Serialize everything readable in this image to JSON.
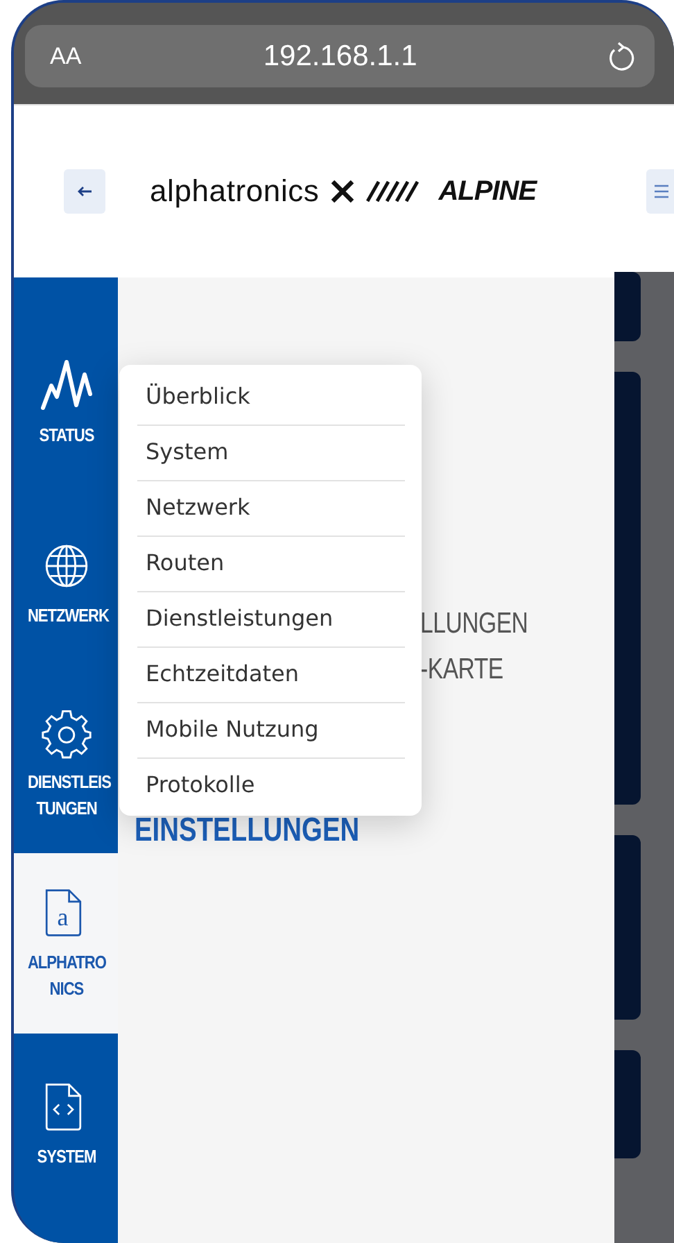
{
  "browser": {
    "text_size_button": "AA",
    "url": "192.168.1.1"
  },
  "header": {
    "logo_text": "alphatronics",
    "brand": "ALPINE"
  },
  "sidebar": {
    "items": [
      {
        "label": "STATUS",
        "kind": "wave",
        "selected": false
      },
      {
        "label": "NETZWERK",
        "kind": "globe",
        "selected": false
      },
      {
        "label": "DIENSTLEIS TUNGEN",
        "kind": "gear",
        "selected": false
      },
      {
        "label": "ALPHATRO NICS",
        "kind": "letter",
        "glyph": "a",
        "selected": true
      },
      {
        "label": "SYSTEM",
        "kind": "code",
        "selected": false
      }
    ]
  },
  "content": {
    "fragments": [
      "LLUNGEN",
      "-KARTE"
    ],
    "heading": "EINSTELLUNGEN"
  },
  "menu": {
    "items": [
      {
        "label": "Überblick"
      },
      {
        "label": "System"
      },
      {
        "label": "Netzwerk"
      },
      {
        "label": "Routen"
      },
      {
        "label": "Dienstleistungen"
      },
      {
        "label": "Echtzeitdaten"
      },
      {
        "label": "Mobile Nutzung"
      },
      {
        "label": "Protokolle"
      }
    ]
  }
}
